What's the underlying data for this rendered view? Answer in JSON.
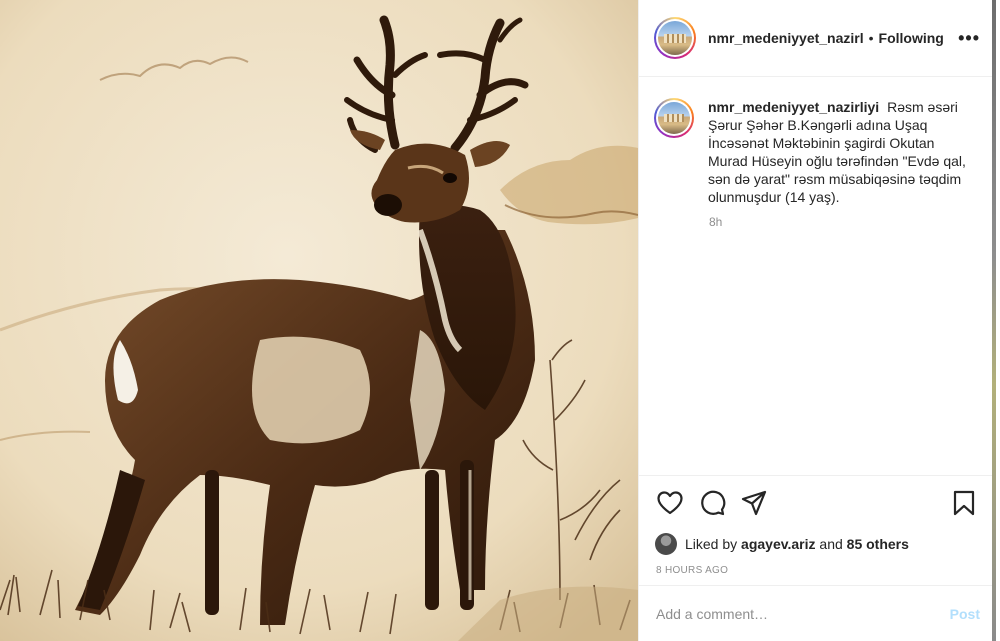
{
  "post": {
    "username": "nmr_medeniyyet_nazirliyi",
    "header_username": "nmr_medeniyyet_nazirl",
    "separator": "•",
    "follow_status": "Following",
    "more_label": "•••",
    "caption": {
      "username": "nmr_medeniyyet_nazirliyi",
      "text": "Rəsm əsəri Şərur Şəhər B.Kəngərli adına Uşaq İncəsənət Məktəbinin şagirdi Okutan Murad Hüseyin oğlu tərəfindən \"Evdə qal, sən də yarat\" rəsm müsabiqəsinə təqdim olunmuşdur (14 yaş).",
      "time": "8h"
    },
    "likes": {
      "prefix": "Liked by",
      "liker": "agayev.ariz",
      "and": "and",
      "others": "85 others"
    },
    "timestamp": "8 HOURS AGO",
    "comment_placeholder": "Add a comment…",
    "post_button": "Post"
  },
  "colors": {
    "text": "#262626",
    "secondary": "#8e8e8e",
    "link_disabled": "#b2dffc",
    "border": "#efefef",
    "paper": "#efe3ca",
    "burn": "#3a2110"
  },
  "icons": [
    "heart-icon",
    "comment-icon",
    "share-icon",
    "bookmark-icon",
    "more-icon"
  ]
}
